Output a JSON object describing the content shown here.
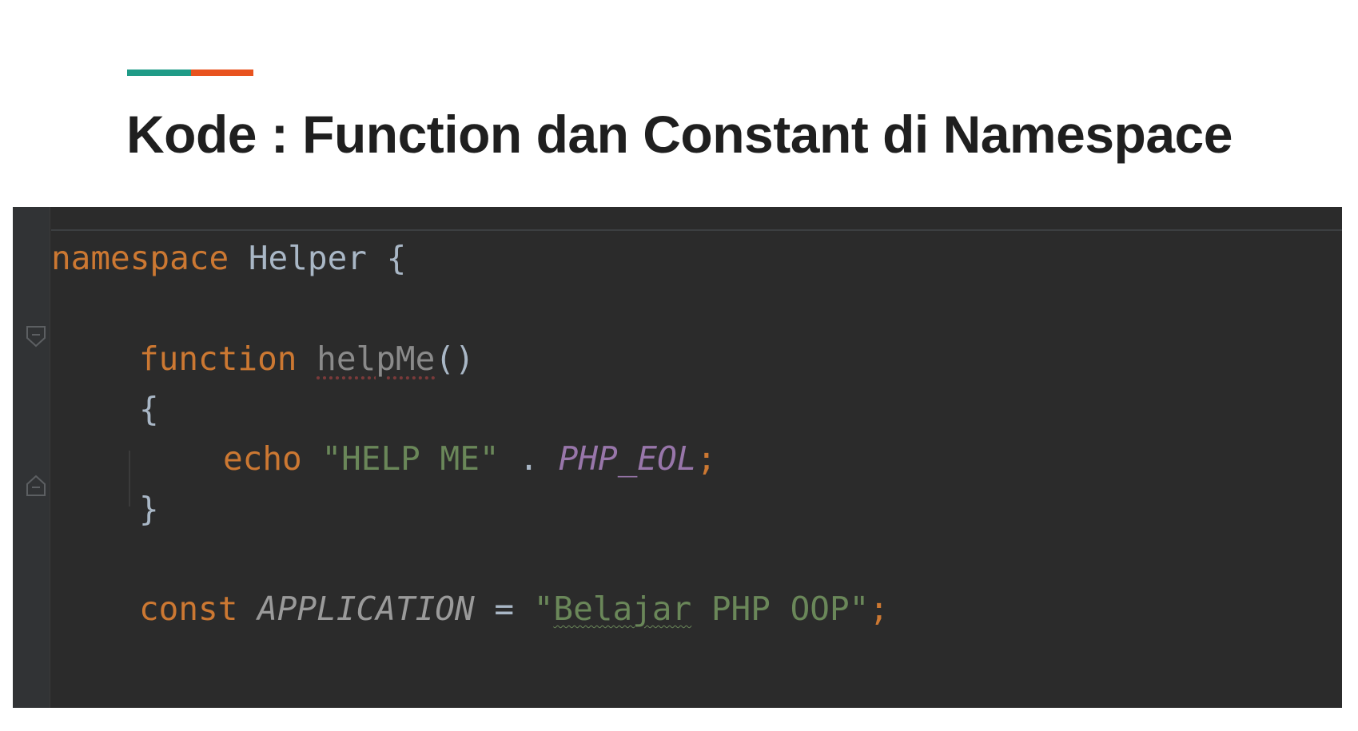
{
  "slide": {
    "title": "Kode : Function dan Constant di Namespace",
    "accent_colors": [
      "#1f9b87",
      "#e8531f"
    ]
  },
  "editor": {
    "background": "#2b2b2b",
    "lines": {
      "l1": {
        "kw": "namespace",
        "name": "Helper",
        "brace": "{"
      },
      "l2": {
        "kw": "function",
        "name": "helpMe",
        "parens": "()"
      },
      "l3": {
        "brace": "{"
      },
      "l4": {
        "kw": "echo",
        "str": "\"HELP ME\"",
        "dot": ".",
        "const": "PHP_EOL",
        "semi": ";"
      },
      "l5": {
        "brace": "}"
      },
      "l6": {
        "kw": "const",
        "name": "APPLICATION",
        "eq": "=",
        "str_open": "\"",
        "str_word": "Belajar",
        "str_rest": " PHP OOP\"",
        "semi": ";"
      }
    },
    "colors": {
      "keyword": "#cc7832",
      "string": "#6a8759",
      "constant": "#9876aa",
      "identifier": "#a9b7c6"
    }
  }
}
